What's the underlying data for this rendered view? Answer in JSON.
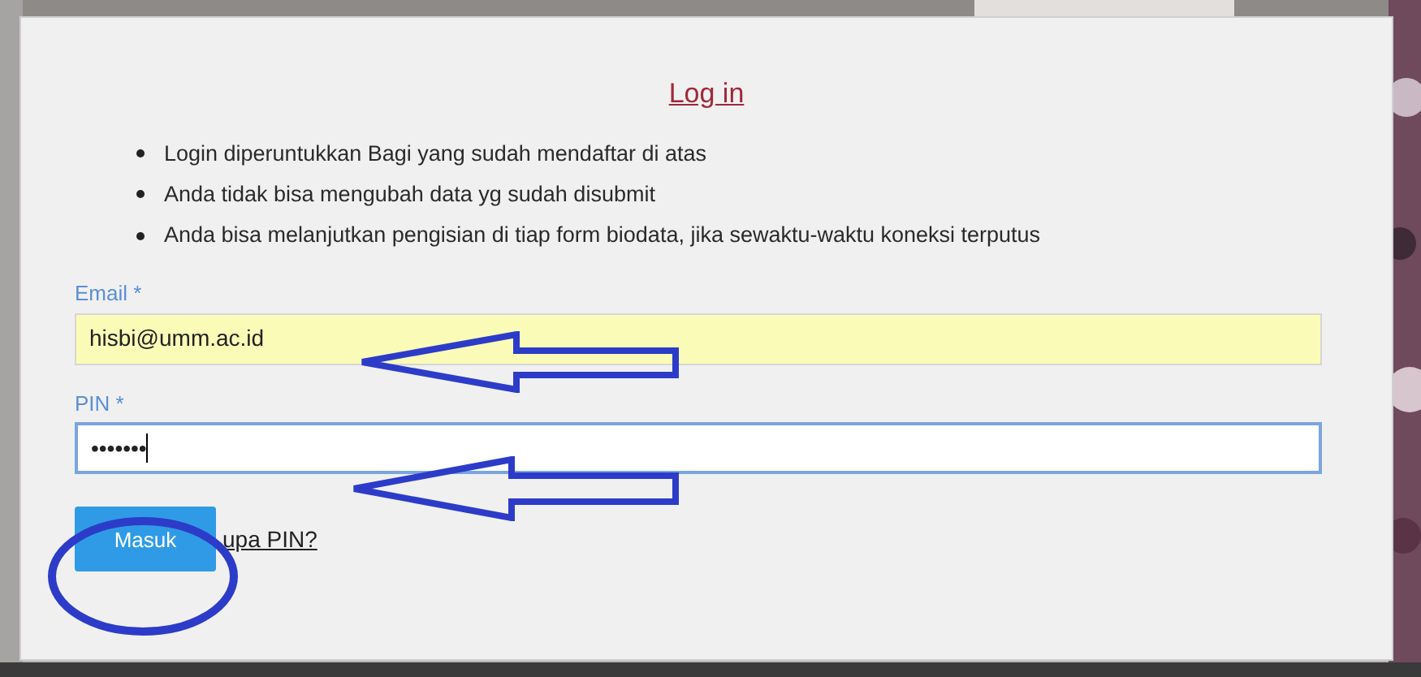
{
  "title": "Log in",
  "notes": [
    "Login diperuntukkan Bagi yang sudah mendaftar di atas",
    "Anda tidak bisa mengubah data yg sudah disubmit",
    "Anda bisa melanjutkan pengisian di tiap form biodata, jika sewaktu-waktu koneksi terputus"
  ],
  "fields": [
    {
      "label": "Email *",
      "value": "hisbi@umm.ac.id",
      "autofilled": true,
      "focused": false
    },
    {
      "label": "PIN *",
      "value": "•••••••",
      "autofilled": false,
      "focused": true
    }
  ],
  "submit_button": "Masuk",
  "forgot_link": "upa PIN?"
}
